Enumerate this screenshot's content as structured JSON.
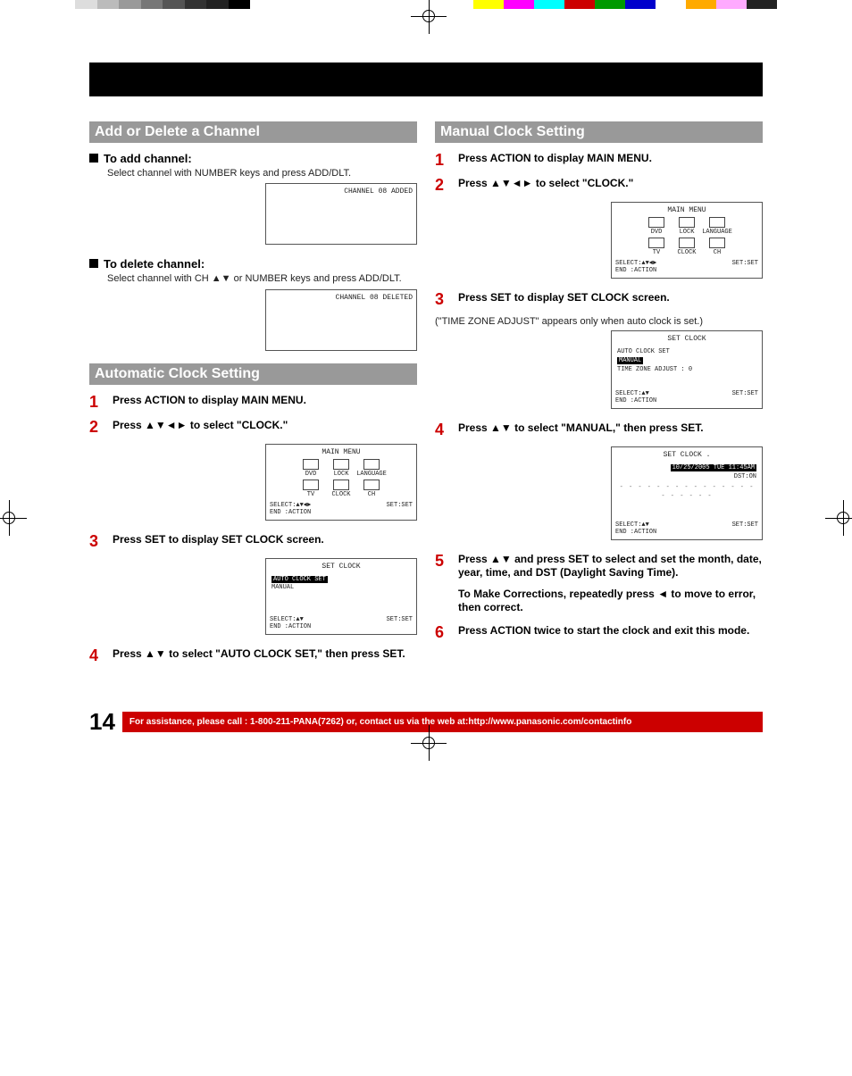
{
  "topbar_colors_left": [
    "#fff",
    "#ddd",
    "#bbb",
    "#999",
    "#777",
    "#555",
    "#333",
    "#222",
    "#000"
  ],
  "topbar_colors_right": [
    "#ff0",
    "#f0f",
    "#0ff",
    "#c00",
    "#090",
    "#00c",
    "#fff",
    "#fa0",
    "#faf",
    "#222"
  ],
  "sections": {
    "add_delete": {
      "title": "Add or Delete a Channel",
      "add_head": "To add channel:",
      "add_body": "Select channel with NUMBER keys and press ADD/DLT.",
      "add_osd": "CHANNEL 08 ADDED",
      "del_head": "To delete channel:",
      "del_body_a": "Select channel with CH ",
      "del_body_b": " or NUMBER keys and press ADD/DLT.",
      "del_osd": "CHANNEL 08 DELETED"
    },
    "auto": {
      "title": "Automatic Clock Setting",
      "s1": "Press ACTION to display MAIN MENU.",
      "s2_a": "Press ",
      "s2_b": " to select \"CLOCK.\"",
      "s3": "Press SET to display SET CLOCK screen.",
      "s4_a": "Press ",
      "s4_b": " to select \"AUTO CLOCK SET,\" then press SET."
    },
    "manual": {
      "title": "Manual Clock Setting",
      "s1": "Press ACTION to display MAIN MENU.",
      "s2_a": "Press ",
      "s2_b": " to select \"CLOCK.\"",
      "s3": "Press SET to display SET CLOCK screen.",
      "s3_note": "(\"TIME ZONE ADJUST\" appears only when auto clock is set.)",
      "s4_a": "Press ",
      "s4_b": " to select \"MANUAL,\" then press SET.",
      "s5_a": "Press ",
      "s5_b": " and press SET to select and set the month, date, year, time, and DST (Daylight Saving Time).",
      "s5_extra_a": "To Make Corrections, repeatedly press ",
      "s5_extra_b": " to move to error, then correct.",
      "s6": "Press ACTION twice to start the clock and exit this mode."
    }
  },
  "arrows": {
    "udlr": "▲▼◄►",
    "ud": "▲▼",
    "left": "◄"
  },
  "osd": {
    "main_menu": {
      "title": "MAIN MENU",
      "row1": [
        "DVD",
        "LOCK",
        "LANGUAGE"
      ],
      "row2": [
        "TV",
        "CLOCK",
        "CH"
      ],
      "foot_l1": "SELECT:▲▼◄►",
      "foot_r1": "SET:SET",
      "foot_l2": "END   :ACTION"
    },
    "set_clock_auto": {
      "title": "SET CLOCK",
      "line1": "AUTO CLOCK SET",
      "line2": "MANUAL",
      "foot_l1": "SELECT:▲▼",
      "foot_r1": "SET:SET",
      "foot_l2": "END   :ACTION"
    },
    "set_clock_manual": {
      "title": "SET CLOCK",
      "line1": "AUTO CLOCK SET",
      "line2": "MANUAL",
      "line3": "TIME ZONE ADJUST : 0",
      "foot_l1": "SELECT:▲▼",
      "foot_r1": "SET:SET",
      "foot_l2": "END   :ACTION"
    },
    "set_clock_time": {
      "title": "SET CLOCK  .",
      "date": "10/25/2005 TUE 11:45AM",
      "dst": "DST:ON",
      "foot_l1": "SELECT:▲▼",
      "foot_r1": "SET:SET",
      "foot_l2": "END   :ACTION"
    }
  },
  "footer": {
    "page": "14",
    "bar": "For assistance, please call : 1-800-211-PANA(7262) or, contact us via the web at:http://www.panasonic.com/contactinfo"
  }
}
